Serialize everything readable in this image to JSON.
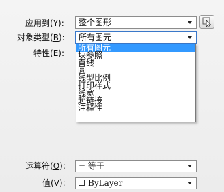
{
  "apply_to": {
    "label": "应用到",
    "key": "Y",
    "suffix": ":",
    "value": "整个图形"
  },
  "object_type": {
    "label": "对象类型",
    "key": "B",
    "suffix": ":",
    "value": "所有图元"
  },
  "properties": {
    "label": "特性",
    "key": "E",
    "suffix": ":"
  },
  "object_type_options": [
    "所有图元",
    "块参照",
    "直线",
    "圆",
    "线型比例",
    "打印样式",
    "线宽",
    "超链接",
    "注释性"
  ],
  "selected_option_index": 0,
  "operator": {
    "label": "运算符",
    "key": "O",
    "suffix": ":",
    "value": "= 等于"
  },
  "value": {
    "label": "值",
    "key": "V",
    "suffix": ":",
    "value": "ByLayer"
  },
  "colors": {
    "selection": "#3399ff",
    "border_active": "#3a78c9"
  },
  "icons": {
    "quick_select_button": "select-objects-icon",
    "dropdown": "chevron-down-icon",
    "color_swatch": "white-swatch"
  }
}
